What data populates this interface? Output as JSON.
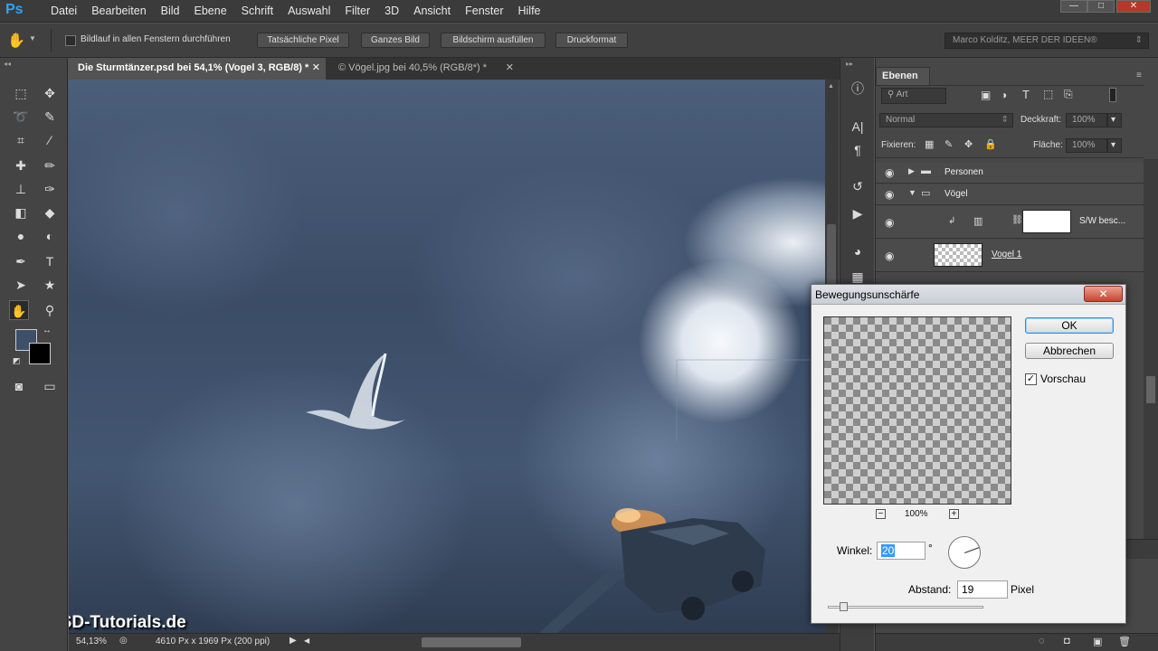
{
  "app": {
    "logo": "Ps"
  },
  "menu": [
    "Datei",
    "Bearbeiten",
    "Bild",
    "Ebene",
    "Schrift",
    "Auswahl",
    "Filter",
    "3D",
    "Ansicht",
    "Fenster",
    "Hilfe"
  ],
  "window_buttons": {
    "minimize": "—",
    "maximize": "□",
    "close": "✕"
  },
  "options_bar": {
    "scroll_all_label": "Bildlauf in allen Fenstern durchführen",
    "scroll_all_checked": false,
    "buttons": [
      "Tatsächliche Pixel",
      "Ganzes Bild",
      "Bildschirm ausfüllen",
      "Druckformat"
    ],
    "profile": "Marco Kolditz, MEER DER IDEEN®"
  },
  "tabs": [
    {
      "label": "Die Sturmtänzer.psd bei 54,1% (Vogel 3, RGB/8) *",
      "close": "✕",
      "active": true
    },
    {
      "label": "© Vögel.jpg bei 40,5% (RGB/8*) *",
      "close": "✕",
      "active": false
    }
  ],
  "canvas": {
    "watermark": "PSD-Tutorials.de"
  },
  "status": {
    "zoom": "54,13%",
    "doc_info": "4610 Px x 1969 Px (200 ppi)"
  },
  "layers_panel": {
    "title": "Ebenen",
    "filter_kind": "Art",
    "blend_mode": "Normal",
    "opacity_label": "Deckkraft:",
    "opacity_value": "100%",
    "lock_label": "Fixieren:",
    "fill_label": "Fläche:",
    "fill_value": "100%",
    "layers": [
      {
        "name": "Personen",
        "type": "group",
        "expanded": false
      },
      {
        "name": "Vögel",
        "type": "group",
        "expanded": true
      },
      {
        "name": "S/W besc...",
        "type": "adjustment"
      },
      {
        "name": "Vogel 1",
        "type": "layer"
      }
    ]
  },
  "dialog": {
    "title": "Bewegungsunschärfe",
    "close": "✕",
    "ok": "OK",
    "cancel": "Abbrechen",
    "preview_label": "Vorschau",
    "preview_checked": true,
    "preview_zoom": "100%",
    "zoom_out": "−",
    "zoom_in": "+",
    "angle_label": "Winkel:",
    "angle_value": "20",
    "angle_unit": "°",
    "distance_label": "Abstand:",
    "distance_value": "19",
    "distance_unit": "Pixel"
  }
}
